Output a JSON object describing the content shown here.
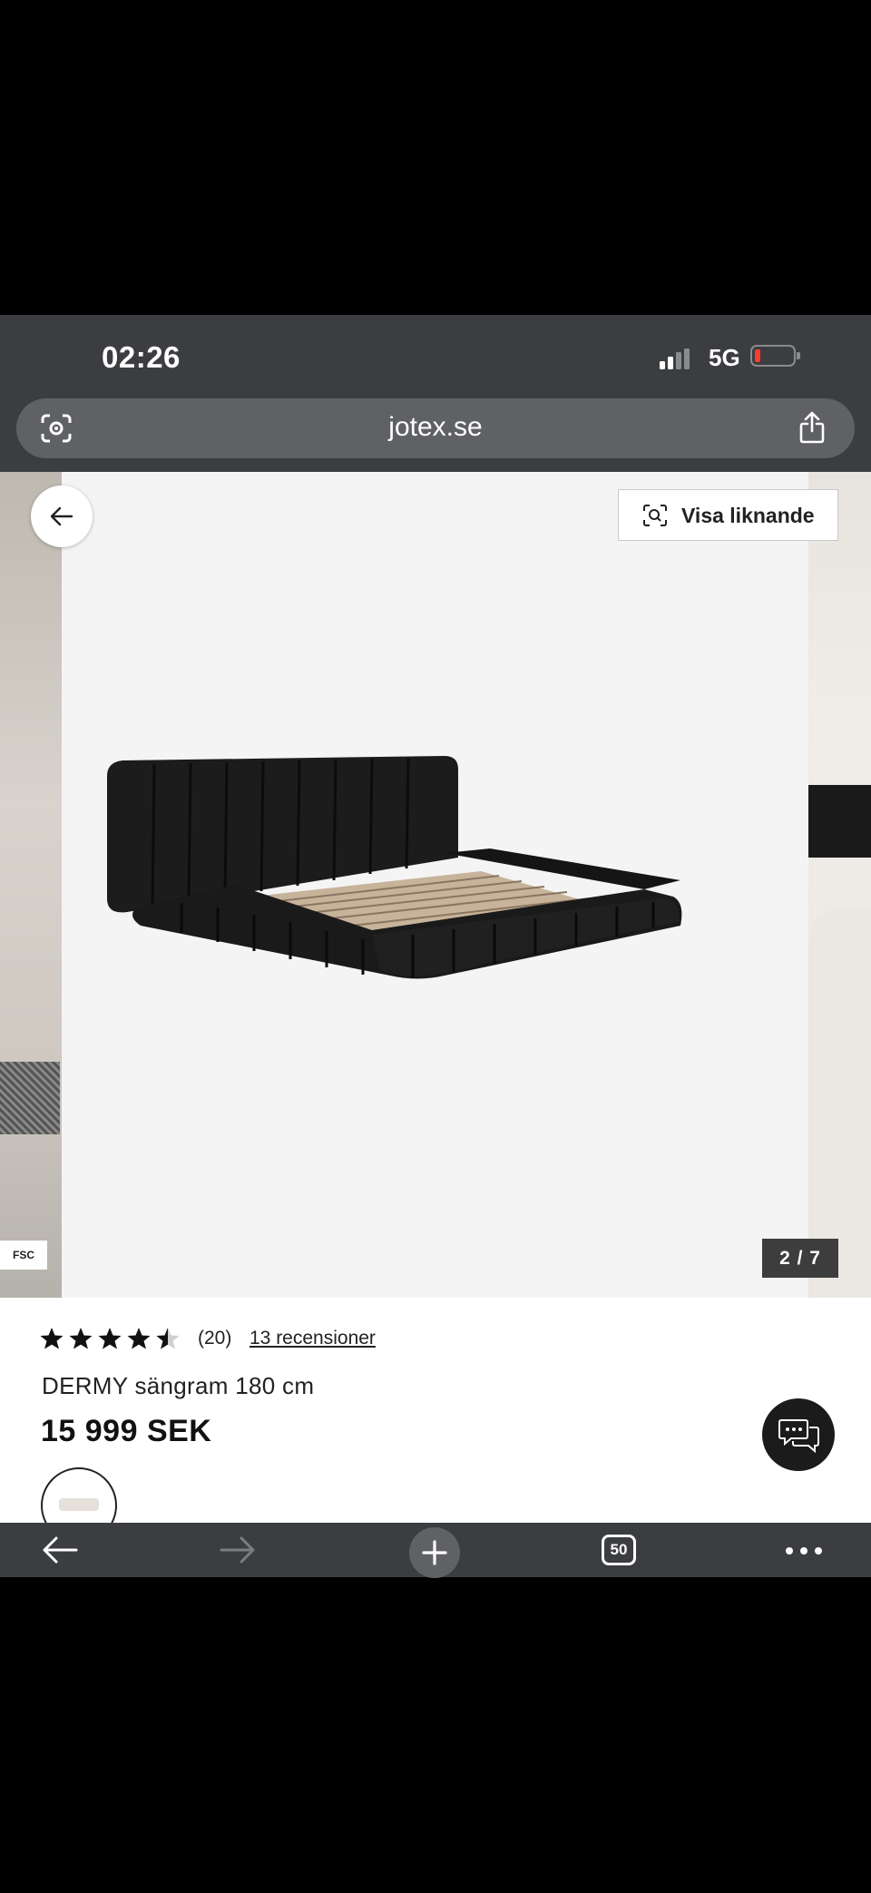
{
  "status_bar": {
    "time": "02:26",
    "network": "5G",
    "battery_low_color": "#ff3b30"
  },
  "browser": {
    "url": "jotex.se",
    "icons": {
      "lens": "visual-search-icon",
      "share": "share-icon"
    }
  },
  "gallery": {
    "visa_liknande_label": "Visa liknande",
    "fsc_badge": "FSC",
    "counter": "2 / 7",
    "current_index": 2,
    "total": 7
  },
  "product": {
    "rating_value": 4.5,
    "rating_max": 5,
    "rating_count": "(20)",
    "reviews_link": "13 recensioner",
    "title": "DERMY sängram 180 cm",
    "price": "15 999 SEK"
  },
  "toolbar": {
    "tabs_count": "50"
  }
}
